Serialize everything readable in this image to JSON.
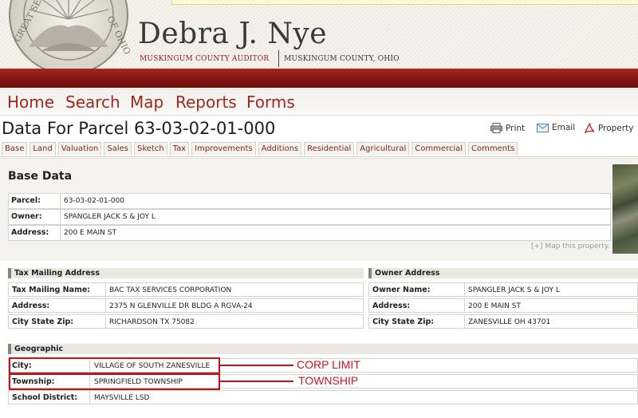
{
  "header": {
    "title": "Debra J. Nye",
    "subtitle_left": "MUSKINGUM COUNTY AUDITOR",
    "subtitle_right": "MUSKINGUM COUNTY, OHIO"
  },
  "nav": {
    "items": [
      "Home",
      "Search",
      "Map",
      "Reports",
      "Forms"
    ]
  },
  "parcel": {
    "title": "Data For Parcel 63-03-02-01-000"
  },
  "tools": {
    "print": "Print",
    "email": "Email",
    "property": "Property"
  },
  "tabs": [
    "Base",
    "Land",
    "Valuation",
    "Sales",
    "Sketch",
    "Tax",
    "Improvements",
    "Additions",
    "Residential",
    "Agricultural",
    "Commercial",
    "Comments"
  ],
  "base_data": {
    "title": "Base Data",
    "rows": [
      {
        "label": "Parcel:",
        "value": "63-03-02-01-000"
      },
      {
        "label": "Owner:",
        "value": "SPANGLER JACK S & JOY L"
      },
      {
        "label": "Address:",
        "value": "200 E MAIN ST"
      }
    ],
    "map_link": "[+] Map this property."
  },
  "tax_mailing": {
    "title": "Tax Mailing Address",
    "rows": [
      {
        "label": "Tax Mailing Name:",
        "value": "BAC TAX SERVICES CORPORATION"
      },
      {
        "label": "Address:",
        "value": "2375 N GLENVILLE DR BLDG A RGVA-24"
      },
      {
        "label": "City State Zip:",
        "value": "RICHARDSON TX 75082"
      }
    ]
  },
  "owner_address": {
    "title": "Owner Address",
    "rows": [
      {
        "label": "Owner Name:",
        "value": "SPANGLER JACK S & JOY L"
      },
      {
        "label": "Address:",
        "value": "200 E MAIN ST"
      },
      {
        "label": "City State Zip:",
        "value": "ZANESVILLE OH 43701"
      }
    ]
  },
  "geographic": {
    "title": "Geographic",
    "rows": [
      {
        "label": "City:",
        "value": "VILLAGE OF SOUTH ZANESVILLE"
      },
      {
        "label": "Township:",
        "value": "SPRINGFIELD TOWNSHIP"
      },
      {
        "label": "School District:",
        "value": "MAYSVILLE LSD"
      }
    ]
  },
  "annotations": {
    "corp_limit": "CORP LIMIT",
    "township": "TOWNSHIP"
  },
  "colors": {
    "brand_red": "#8c1a15",
    "nav_red": "#a3261f",
    "annotation_red": "#d0141e"
  }
}
